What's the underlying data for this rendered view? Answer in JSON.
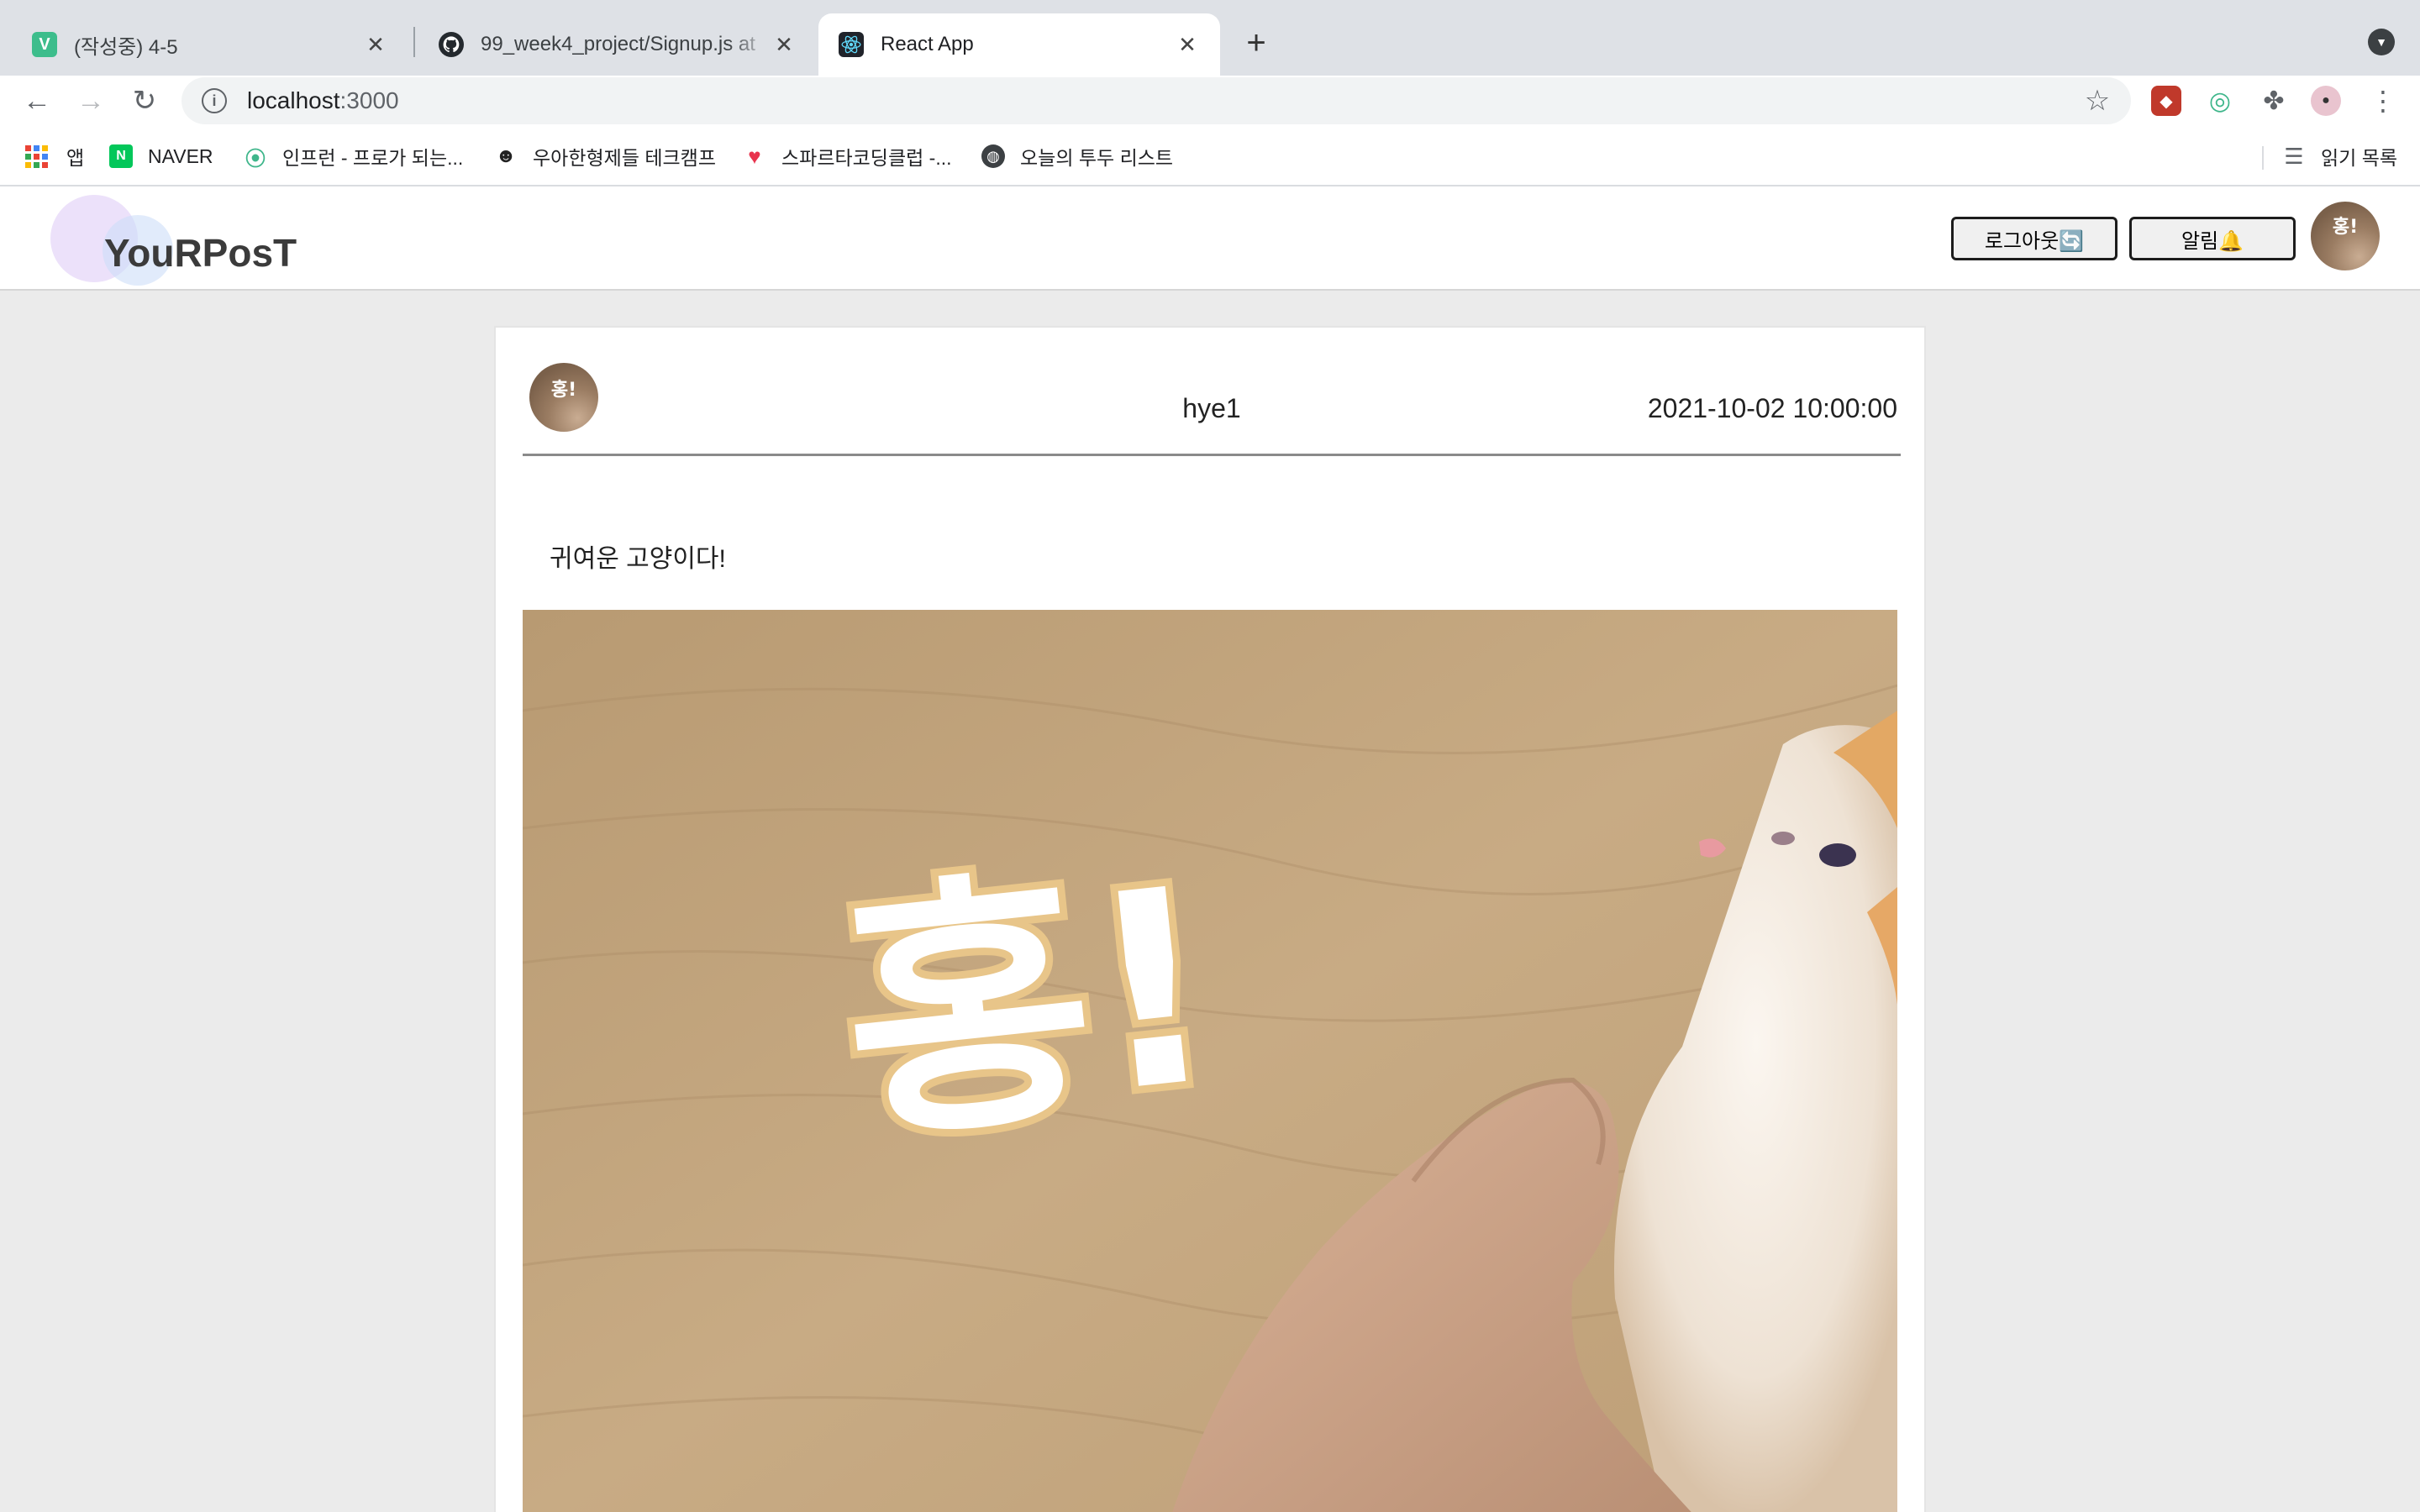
{
  "browser": {
    "tabs": [
      {
        "title": "(작성중) 4-5",
        "favicon": "v-icon",
        "favicon_letter": "V",
        "active": false
      },
      {
        "title": "99_week4_project/Signup.js at",
        "favicon": "github-icon",
        "active": false
      },
      {
        "title": "React App",
        "favicon": "react-icon",
        "active": true
      }
    ],
    "url_host": "localhost",
    "url_port": ":3000",
    "bookmarks": [
      {
        "label": "앱",
        "icon": "apps-grid-icon"
      },
      {
        "label": "NAVER",
        "icon": "naver-icon",
        "icon_letter": "N"
      },
      {
        "label": "인프런 - 프로가 되는...",
        "icon": "inflearn-icon"
      },
      {
        "label": "우아한형제들 테크캠프",
        "icon": "woowa-icon"
      },
      {
        "label": "스파르타코딩클럽 -...",
        "icon": "sparta-icon"
      },
      {
        "label": "오늘의 투두 리스트",
        "icon": "globe-icon"
      }
    ],
    "reading_list": "읽기 목록"
  },
  "app": {
    "logo": "YouRPosT",
    "logout_label": "로그아웃🔄",
    "alarm_label": "알림🔔",
    "profile_avatar_text": "홍!"
  },
  "post": {
    "author": "hye1",
    "date": "2021-10-02 10:00:00",
    "content": "귀여운 고양이다!",
    "avatar_text": "홍!",
    "image_caption_text": "홍!"
  },
  "colors": {
    "tabbar_bg": "#dee1e6",
    "page_bg": "#ebebeb",
    "naver_green": "#03c75a",
    "vrew_green": "#3dbd8c"
  }
}
